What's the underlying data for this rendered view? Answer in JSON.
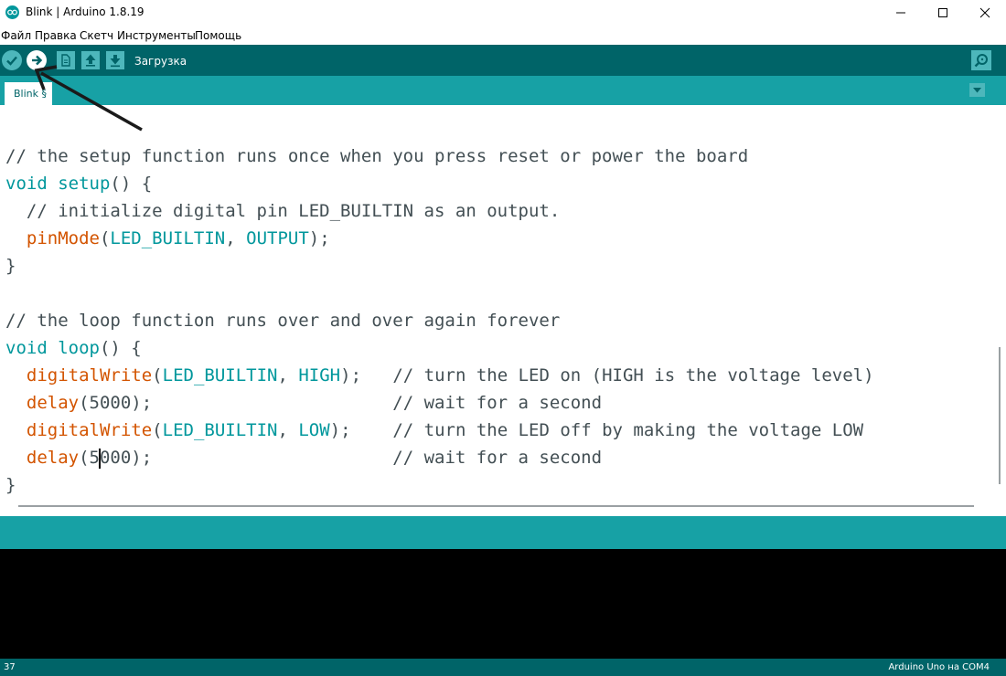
{
  "window": {
    "title": "Blink | Arduino 1.8.19"
  },
  "menu": {
    "items": [
      "Файл",
      "Правка",
      "Скетч",
      "Инструменты",
      "Помощь"
    ]
  },
  "toolbar": {
    "status_label": "Загрузка",
    "buttons": [
      "verify-button",
      "upload-button",
      "new-button",
      "open-button",
      "save-button"
    ],
    "active_button": "upload-button"
  },
  "tabs": [
    {
      "label": "Blink §"
    }
  ],
  "editor": {
    "lines": [
      {
        "parts": [
          {
            "t": "// the setup function runs once when you press reset or power the board",
            "c": "cm"
          }
        ]
      },
      {
        "parts": [
          {
            "t": "void",
            "c": "kw"
          },
          {
            "t": " ",
            "c": ""
          },
          {
            "t": "setup",
            "c": "kw"
          },
          {
            "t": "() {",
            "c": ""
          }
        ]
      },
      {
        "parts": [
          {
            "t": "  // initialize digital pin LED_BUILTIN as an output.",
            "c": "cm"
          }
        ]
      },
      {
        "parts": [
          {
            "t": "  ",
            "c": ""
          },
          {
            "t": "pinMode",
            "c": "fn"
          },
          {
            "t": "(",
            "c": ""
          },
          {
            "t": "LED_BUILTIN",
            "c": "kw"
          },
          {
            "t": ", ",
            "c": ""
          },
          {
            "t": "OUTPUT",
            "c": "kw"
          },
          {
            "t": ");",
            "c": ""
          }
        ]
      },
      {
        "parts": [
          {
            "t": "}",
            "c": ""
          }
        ]
      },
      {
        "parts": [
          {
            "t": "",
            "c": ""
          }
        ]
      },
      {
        "parts": [
          {
            "t": "// the loop function runs over and over again forever",
            "c": "cm"
          }
        ]
      },
      {
        "parts": [
          {
            "t": "void",
            "c": "kw"
          },
          {
            "t": " ",
            "c": ""
          },
          {
            "t": "loop",
            "c": "kw"
          },
          {
            "t": "() {",
            "c": ""
          }
        ]
      },
      {
        "parts": [
          {
            "t": "  ",
            "c": ""
          },
          {
            "t": "digitalWrite",
            "c": "fn"
          },
          {
            "t": "(",
            "c": ""
          },
          {
            "t": "LED_BUILTIN",
            "c": "kw"
          },
          {
            "t": ", ",
            "c": ""
          },
          {
            "t": "HIGH",
            "c": "kw"
          },
          {
            "t": ");   // turn the LED on (HIGH is the voltage level)",
            "c": ""
          }
        ]
      },
      {
        "parts": [
          {
            "t": "  ",
            "c": ""
          },
          {
            "t": "delay",
            "c": "fn"
          },
          {
            "t": "(5000);                       // wait for a second",
            "c": ""
          }
        ]
      },
      {
        "parts": [
          {
            "t": "  ",
            "c": ""
          },
          {
            "t": "digitalWrite",
            "c": "fn"
          },
          {
            "t": "(",
            "c": ""
          },
          {
            "t": "LED_BUILTIN",
            "c": "kw"
          },
          {
            "t": ", ",
            "c": ""
          },
          {
            "t": "LOW",
            "c": "kw"
          },
          {
            "t": ");    // turn the LED off by making the voltage LOW",
            "c": ""
          }
        ]
      },
      {
        "parts": [
          {
            "t": "  ",
            "c": ""
          },
          {
            "t": "delay",
            "c": "fn"
          },
          {
            "t": "(5",
            "c": ""
          },
          {
            "t": "|",
            "c": "caret"
          },
          {
            "t": "000);                       // wait for a second",
            "c": ""
          }
        ]
      },
      {
        "parts": [
          {
            "t": "}",
            "c": ""
          }
        ]
      }
    ]
  },
  "status": {
    "line_number": "37",
    "board": "Arduino Uno на COM4"
  },
  "colors": {
    "toolbar": "#006468",
    "tabbar": "#17a1a5",
    "keyword": "#00979c",
    "function": "#d35400",
    "console": "#000000"
  }
}
